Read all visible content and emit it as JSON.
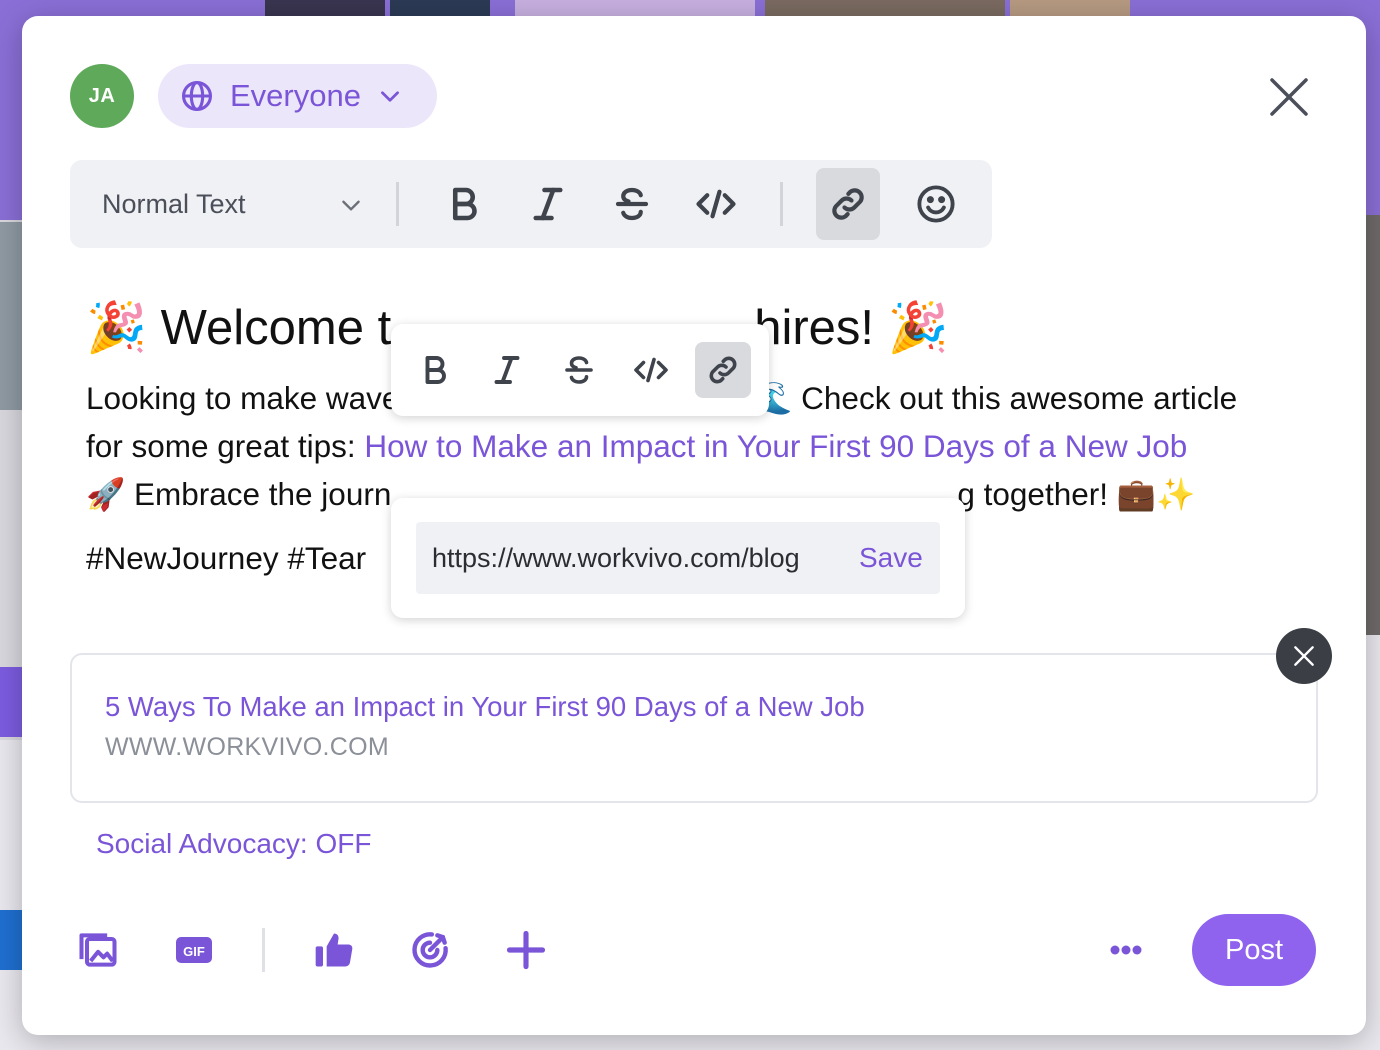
{
  "composer": {
    "avatar_initials": "JA",
    "audience_label": "Everyone",
    "toolbar": {
      "text_style": "Normal Text"
    },
    "content": {
      "heading_emoji_start": "🎉",
      "heading_text_start": "Welcome t",
      "heading_text_end": "hires!",
      "heading_emoji_end": "🎉",
      "para_text_1": "Looking to make waves",
      "para_text_2": "🌊 Check out this awesome article",
      "para_text_3": "for some great tips: ",
      "link_text": "How to Make an Impact in Your First 90 Days of a New Job",
      "para_text_4": "🚀 Embrace the journ",
      "para_text_5": "g together! 💼✨",
      "tags_text": "#NewJourney #Tear"
    },
    "link_editor": {
      "url_value": "https://www.workvivo.com/blog",
      "save_label": "Save"
    },
    "link_preview": {
      "title": "5 Ways To Make an Impact in Your First 90 Days of a New Job",
      "domain": "WWW.WORKVIVO.COM"
    },
    "social_advocacy_label": "Social Advocacy: OFF",
    "post_label": "Post"
  },
  "colors": {
    "accent": "#7a55d8",
    "post_button": "#8f63ee",
    "avatar_bg": "#5fa95a"
  }
}
